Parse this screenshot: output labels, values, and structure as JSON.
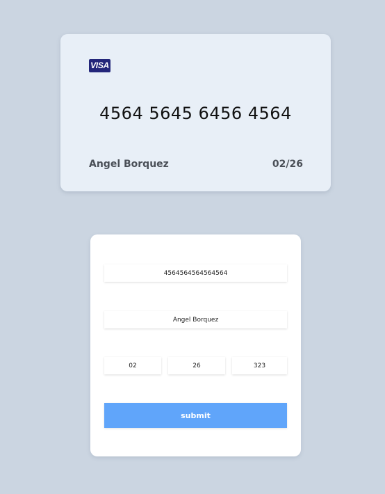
{
  "card": {
    "brand": "VISA",
    "number": "4564 5645 6456 4564",
    "holder": "Angel Borquez",
    "expiry": "02/26"
  },
  "form": {
    "number_value": "4564564564564564",
    "name_value": "Angel Borquez",
    "month_value": "02",
    "year_value": "26",
    "cvv_value": "323",
    "submit_label": "submit"
  },
  "colors": {
    "page_background": "#cbd5e1",
    "card_background": "#e8eff7",
    "visa_blue": "#23267a",
    "submit_blue": "#60a5fa"
  }
}
